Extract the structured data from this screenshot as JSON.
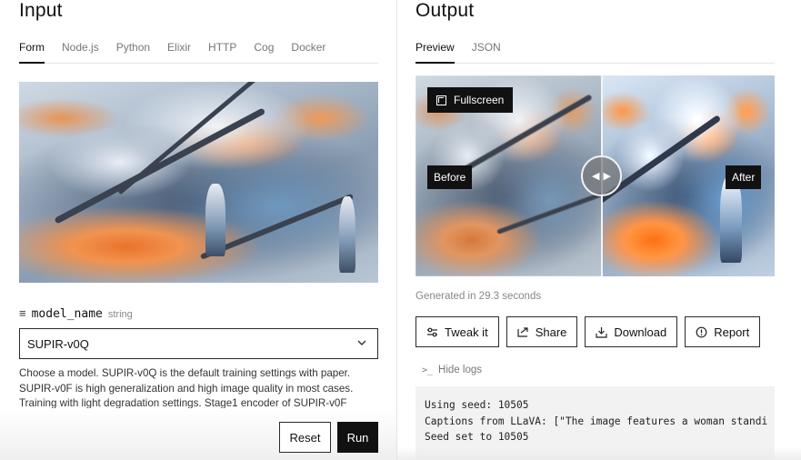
{
  "input": {
    "title": "Input",
    "tabs": [
      "Form",
      "Node.js",
      "Python",
      "Elixir",
      "HTTP",
      "Cog",
      "Docker"
    ],
    "field": {
      "name": "model_name",
      "type": "string",
      "value": "SUPIR-v0Q",
      "help": "Choose a model. SUPIR-v0Q is the default training settings with paper. SUPIR-v0F is high generalization and high image quality in most cases. Training with light degradation settings. Stage1 encoder of SUPIR-v0F"
    },
    "reset_label": "Reset",
    "run_label": "Run"
  },
  "output": {
    "title": "Output",
    "tabs": [
      "Preview",
      "JSON"
    ],
    "fullscreen_label": "Fullscreen",
    "before_label": "Before",
    "after_label": "After",
    "generated": "Generated in 29.3 seconds",
    "actions": {
      "tweak": "Tweak it",
      "share": "Share",
      "download": "Download",
      "report": "Report"
    },
    "hide_logs": "Hide logs",
    "logs": [
      "Using seed: 10505",
      "Captions from LLaVA: [\"The image features a woman standi",
      "Seed set to 10505"
    ]
  },
  "icons": [
    "menu-icon",
    "chevron-down-icon",
    "fullscreen-icon",
    "compare-handle-icon",
    "sliders-icon",
    "share-icon",
    "download-icon",
    "report-icon",
    "terminal-icon"
  ]
}
